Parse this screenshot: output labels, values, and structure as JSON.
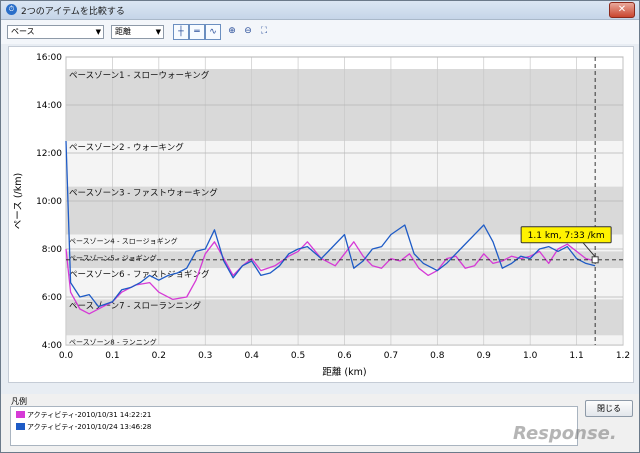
{
  "window": {
    "title": "2つのアイテムを比較する",
    "close": "✕"
  },
  "toolbar": {
    "metric_select": "ペース",
    "axis_select": "距離",
    "icons": [
      "grid-icon",
      "horizontal-lines-icon",
      "smooth-line-icon",
      "zoom-in-icon",
      "zoom-out-icon",
      "fit-icon"
    ]
  },
  "chart_data": {
    "type": "line",
    "xlabel": "距離 (km)",
    "ylabel": "ペース (/km)",
    "xlim": [
      0.0,
      1.2
    ],
    "ylim": [
      4.0,
      16.0
    ],
    "xticks": [
      "0.0",
      "0.1",
      "0.2",
      "0.3",
      "0.4",
      "0.5",
      "0.6",
      "0.7",
      "0.8",
      "0.9",
      "1.0",
      "1.1",
      "1.2"
    ],
    "yticks": [
      "4:00",
      "6:00",
      "8:00",
      "10:00",
      "12:00",
      "14:00",
      "16:00"
    ],
    "zones": [
      {
        "label": "ペースゾーン1 - スローウォーキング",
        "from": 12.5,
        "to": 15.5
      },
      {
        "label": "ペースゾーン2 - ウォーキング",
        "from": 10.6,
        "to": 12.5
      },
      {
        "label": "ペースゾーン3 - ファストウォーキング",
        "from": 8.6,
        "to": 10.6
      },
      {
        "label": "ペースゾーン4 - スロージョギング",
        "from": 7.9,
        "to": 8.6
      },
      {
        "label": "ペースゾーン5 - ジョギング",
        "from": 7.2,
        "to": 7.9
      },
      {
        "label": "ペースゾーン6 - ファストジョギング",
        "from": 5.9,
        "to": 7.2
      },
      {
        "label": "ペースゾーン7 - スローランニング",
        "from": 4.4,
        "to": 5.9
      },
      {
        "label": "ペースゾーン8 - ランニング",
        "from": 4.0,
        "to": 4.4
      }
    ],
    "series": [
      {
        "name": "アクティビティ-2010/10/31 14:22:21",
        "color": "#d63ad6",
        "x": [
          0.0,
          0.01,
          0.03,
          0.05,
          0.08,
          0.1,
          0.12,
          0.15,
          0.18,
          0.2,
          0.23,
          0.26,
          0.28,
          0.3,
          0.32,
          0.34,
          0.36,
          0.38,
          0.4,
          0.42,
          0.45,
          0.48,
          0.5,
          0.52,
          0.55,
          0.58,
          0.6,
          0.62,
          0.64,
          0.66,
          0.68,
          0.7,
          0.72,
          0.74,
          0.76,
          0.78,
          0.8,
          0.82,
          0.84,
          0.86,
          0.88,
          0.9,
          0.92,
          0.94,
          0.96,
          0.98,
          1.0,
          1.02,
          1.04,
          1.06,
          1.08,
          1.1,
          1.12,
          1.14
        ],
        "y": [
          8.0,
          6.2,
          5.5,
          5.3,
          5.6,
          5.8,
          6.2,
          6.5,
          6.6,
          6.2,
          5.9,
          6.0,
          6.7,
          7.8,
          8.3,
          7.6,
          6.9,
          7.3,
          7.6,
          7.1,
          7.3,
          7.7,
          7.9,
          8.3,
          7.6,
          7.3,
          7.8,
          8.3,
          7.7,
          7.3,
          7.2,
          7.6,
          7.5,
          7.8,
          7.2,
          6.9,
          7.1,
          7.6,
          7.7,
          7.2,
          7.3,
          7.8,
          7.4,
          7.5,
          7.7,
          7.6,
          7.7,
          7.9,
          7.4,
          8.0,
          8.2,
          7.9,
          7.6,
          7.5
        ]
      },
      {
        "name": "アクティビティ-2010/10/24 13:46:28",
        "color": "#1e5bc6",
        "x": [
          0.0,
          0.01,
          0.03,
          0.05,
          0.07,
          0.1,
          0.12,
          0.14,
          0.16,
          0.18,
          0.2,
          0.22,
          0.24,
          0.26,
          0.28,
          0.3,
          0.32,
          0.34,
          0.36,
          0.38,
          0.4,
          0.42,
          0.44,
          0.46,
          0.48,
          0.5,
          0.52,
          0.55,
          0.57,
          0.6,
          0.62,
          0.64,
          0.66,
          0.68,
          0.7,
          0.73,
          0.75,
          0.77,
          0.8,
          0.82,
          0.85,
          0.88,
          0.9,
          0.92,
          0.94,
          0.96,
          0.98,
          1.0,
          1.02,
          1.04,
          1.06,
          1.08,
          1.1,
          1.12,
          1.14
        ],
        "y": [
          12.5,
          6.6,
          6.0,
          6.1,
          5.6,
          5.8,
          6.3,
          6.4,
          6.6,
          6.9,
          6.7,
          6.9,
          7.0,
          7.2,
          7.9,
          8.0,
          8.8,
          7.5,
          6.8,
          7.3,
          7.5,
          6.9,
          7.0,
          7.3,
          7.8,
          8.0,
          8.1,
          7.6,
          8.0,
          8.6,
          7.2,
          7.5,
          8.0,
          8.1,
          8.6,
          9.0,
          7.8,
          7.4,
          7.1,
          7.4,
          8.0,
          8.6,
          9.0,
          8.3,
          7.2,
          7.4,
          7.7,
          7.6,
          8.0,
          8.1,
          7.9,
          8.1,
          7.6,
          7.4,
          7.3
        ]
      }
    ],
    "cursor": {
      "x": 1.14,
      "y": 7.55,
      "tooltip": "1.1 km, 7:33 /km"
    }
  },
  "legend": {
    "title": "凡例",
    "items": [
      {
        "label": "アクティビティ-2010/10/31 14:22:21",
        "color": "#d63ad6"
      },
      {
        "label": "アクティビティ-2010/10/24 13:46:28",
        "color": "#1e5bc6"
      }
    ]
  },
  "buttons": {
    "close": "閉じる"
  },
  "watermark": "Response."
}
